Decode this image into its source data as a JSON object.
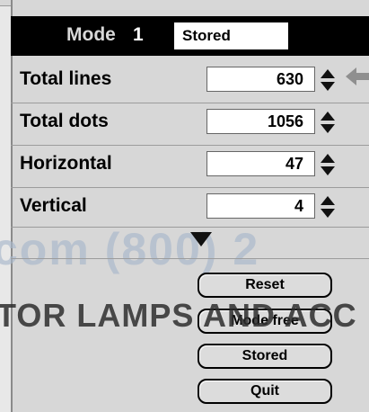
{
  "header": {
    "mode_label": "Mode",
    "mode_number": "1",
    "status": "Stored"
  },
  "rows": [
    {
      "label": "Total lines",
      "value": "630"
    },
    {
      "label": "Total dots",
      "value": "1056"
    },
    {
      "label": "Horizontal",
      "value": "47"
    },
    {
      "label": "Vertical",
      "value": "4"
    }
  ],
  "watermark": {
    "line1": "com (800) 2",
    "line2": "TOR LAMPS AND ACC"
  },
  "buttons": {
    "reset": "Reset",
    "mode_free": "Mode free",
    "stored": "Stored",
    "quit": "Quit"
  },
  "icons": {
    "spinner": "up-down-spinner-icon",
    "back": "back-arrow-icon",
    "more": "down-triangle-icon"
  }
}
